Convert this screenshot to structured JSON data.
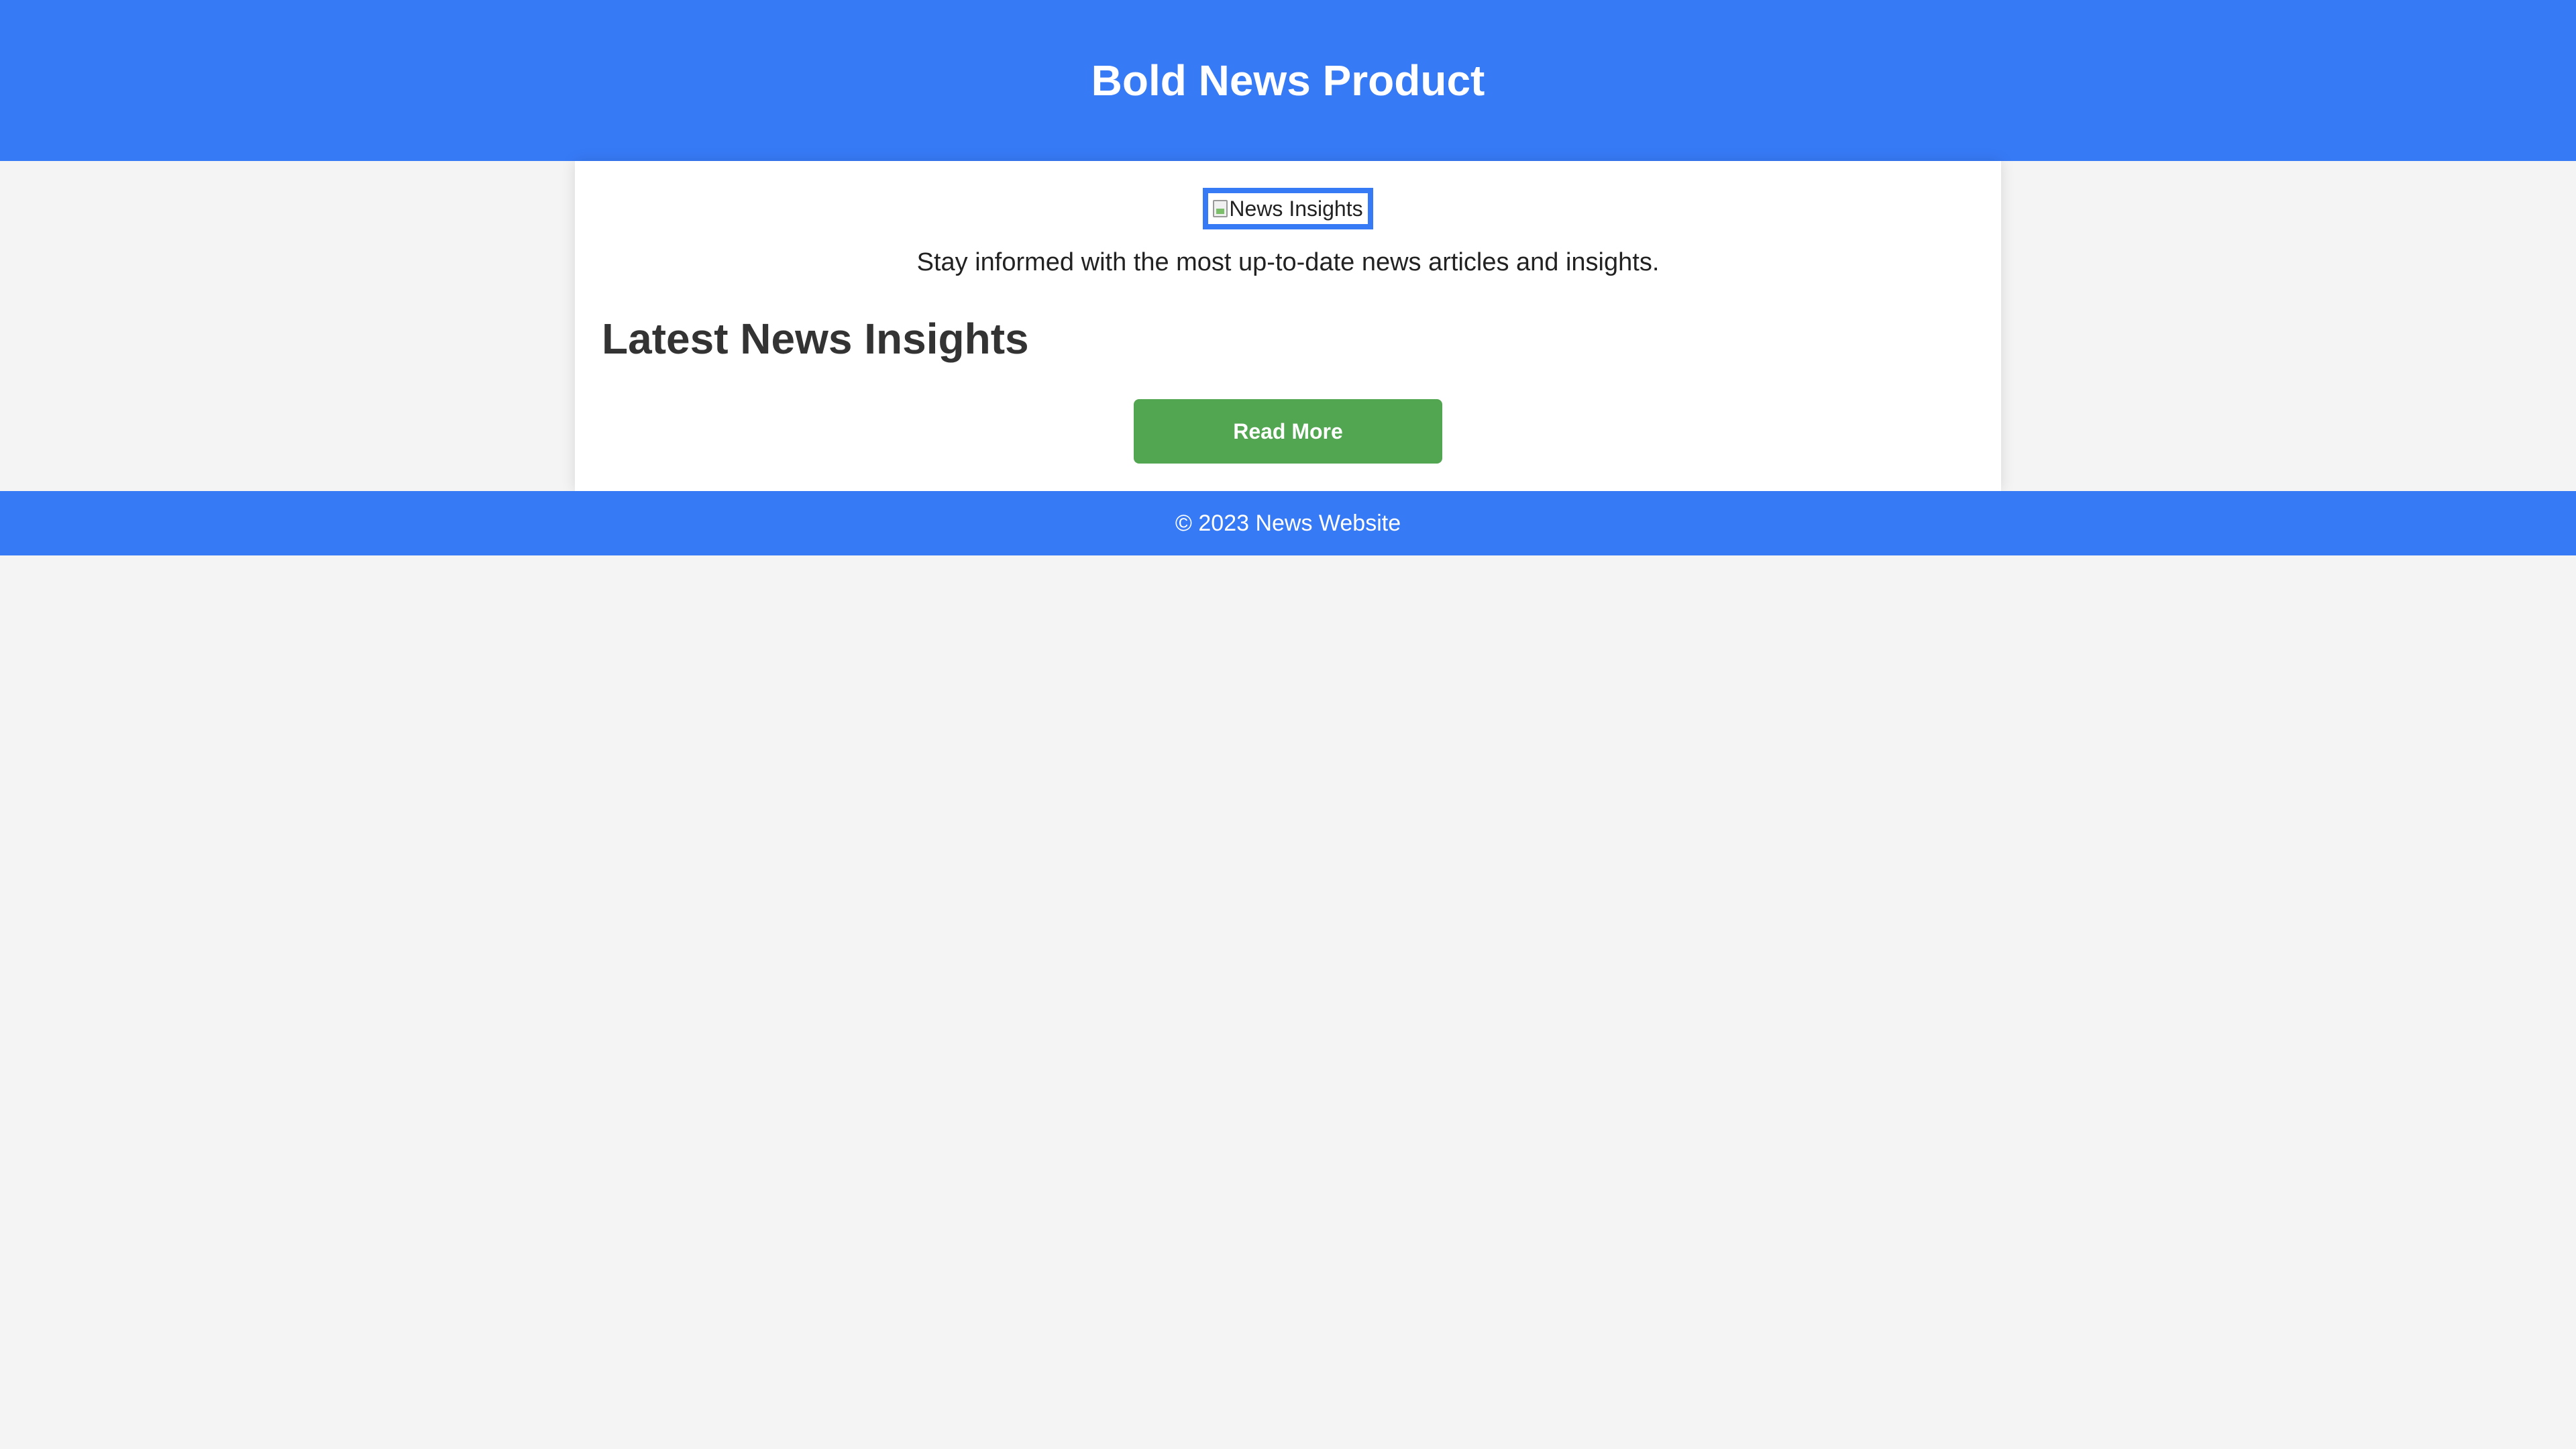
{
  "header": {
    "title": "Bold News Product"
  },
  "main": {
    "image_alt": "News Insights",
    "intro_text": "Stay informed with the most up-to-date news articles and insights.",
    "section_title": "Latest News Insights",
    "read_more_label": "Read More"
  },
  "footer": {
    "copyright": "© 2023 News Website"
  },
  "colors": {
    "brand_blue": "#377af6",
    "button_green": "#53a651",
    "page_background": "#f4f4f4",
    "card_background": "#ffffff",
    "heading_text": "#333333"
  },
  "icons": {
    "image": "broken-image-icon"
  }
}
